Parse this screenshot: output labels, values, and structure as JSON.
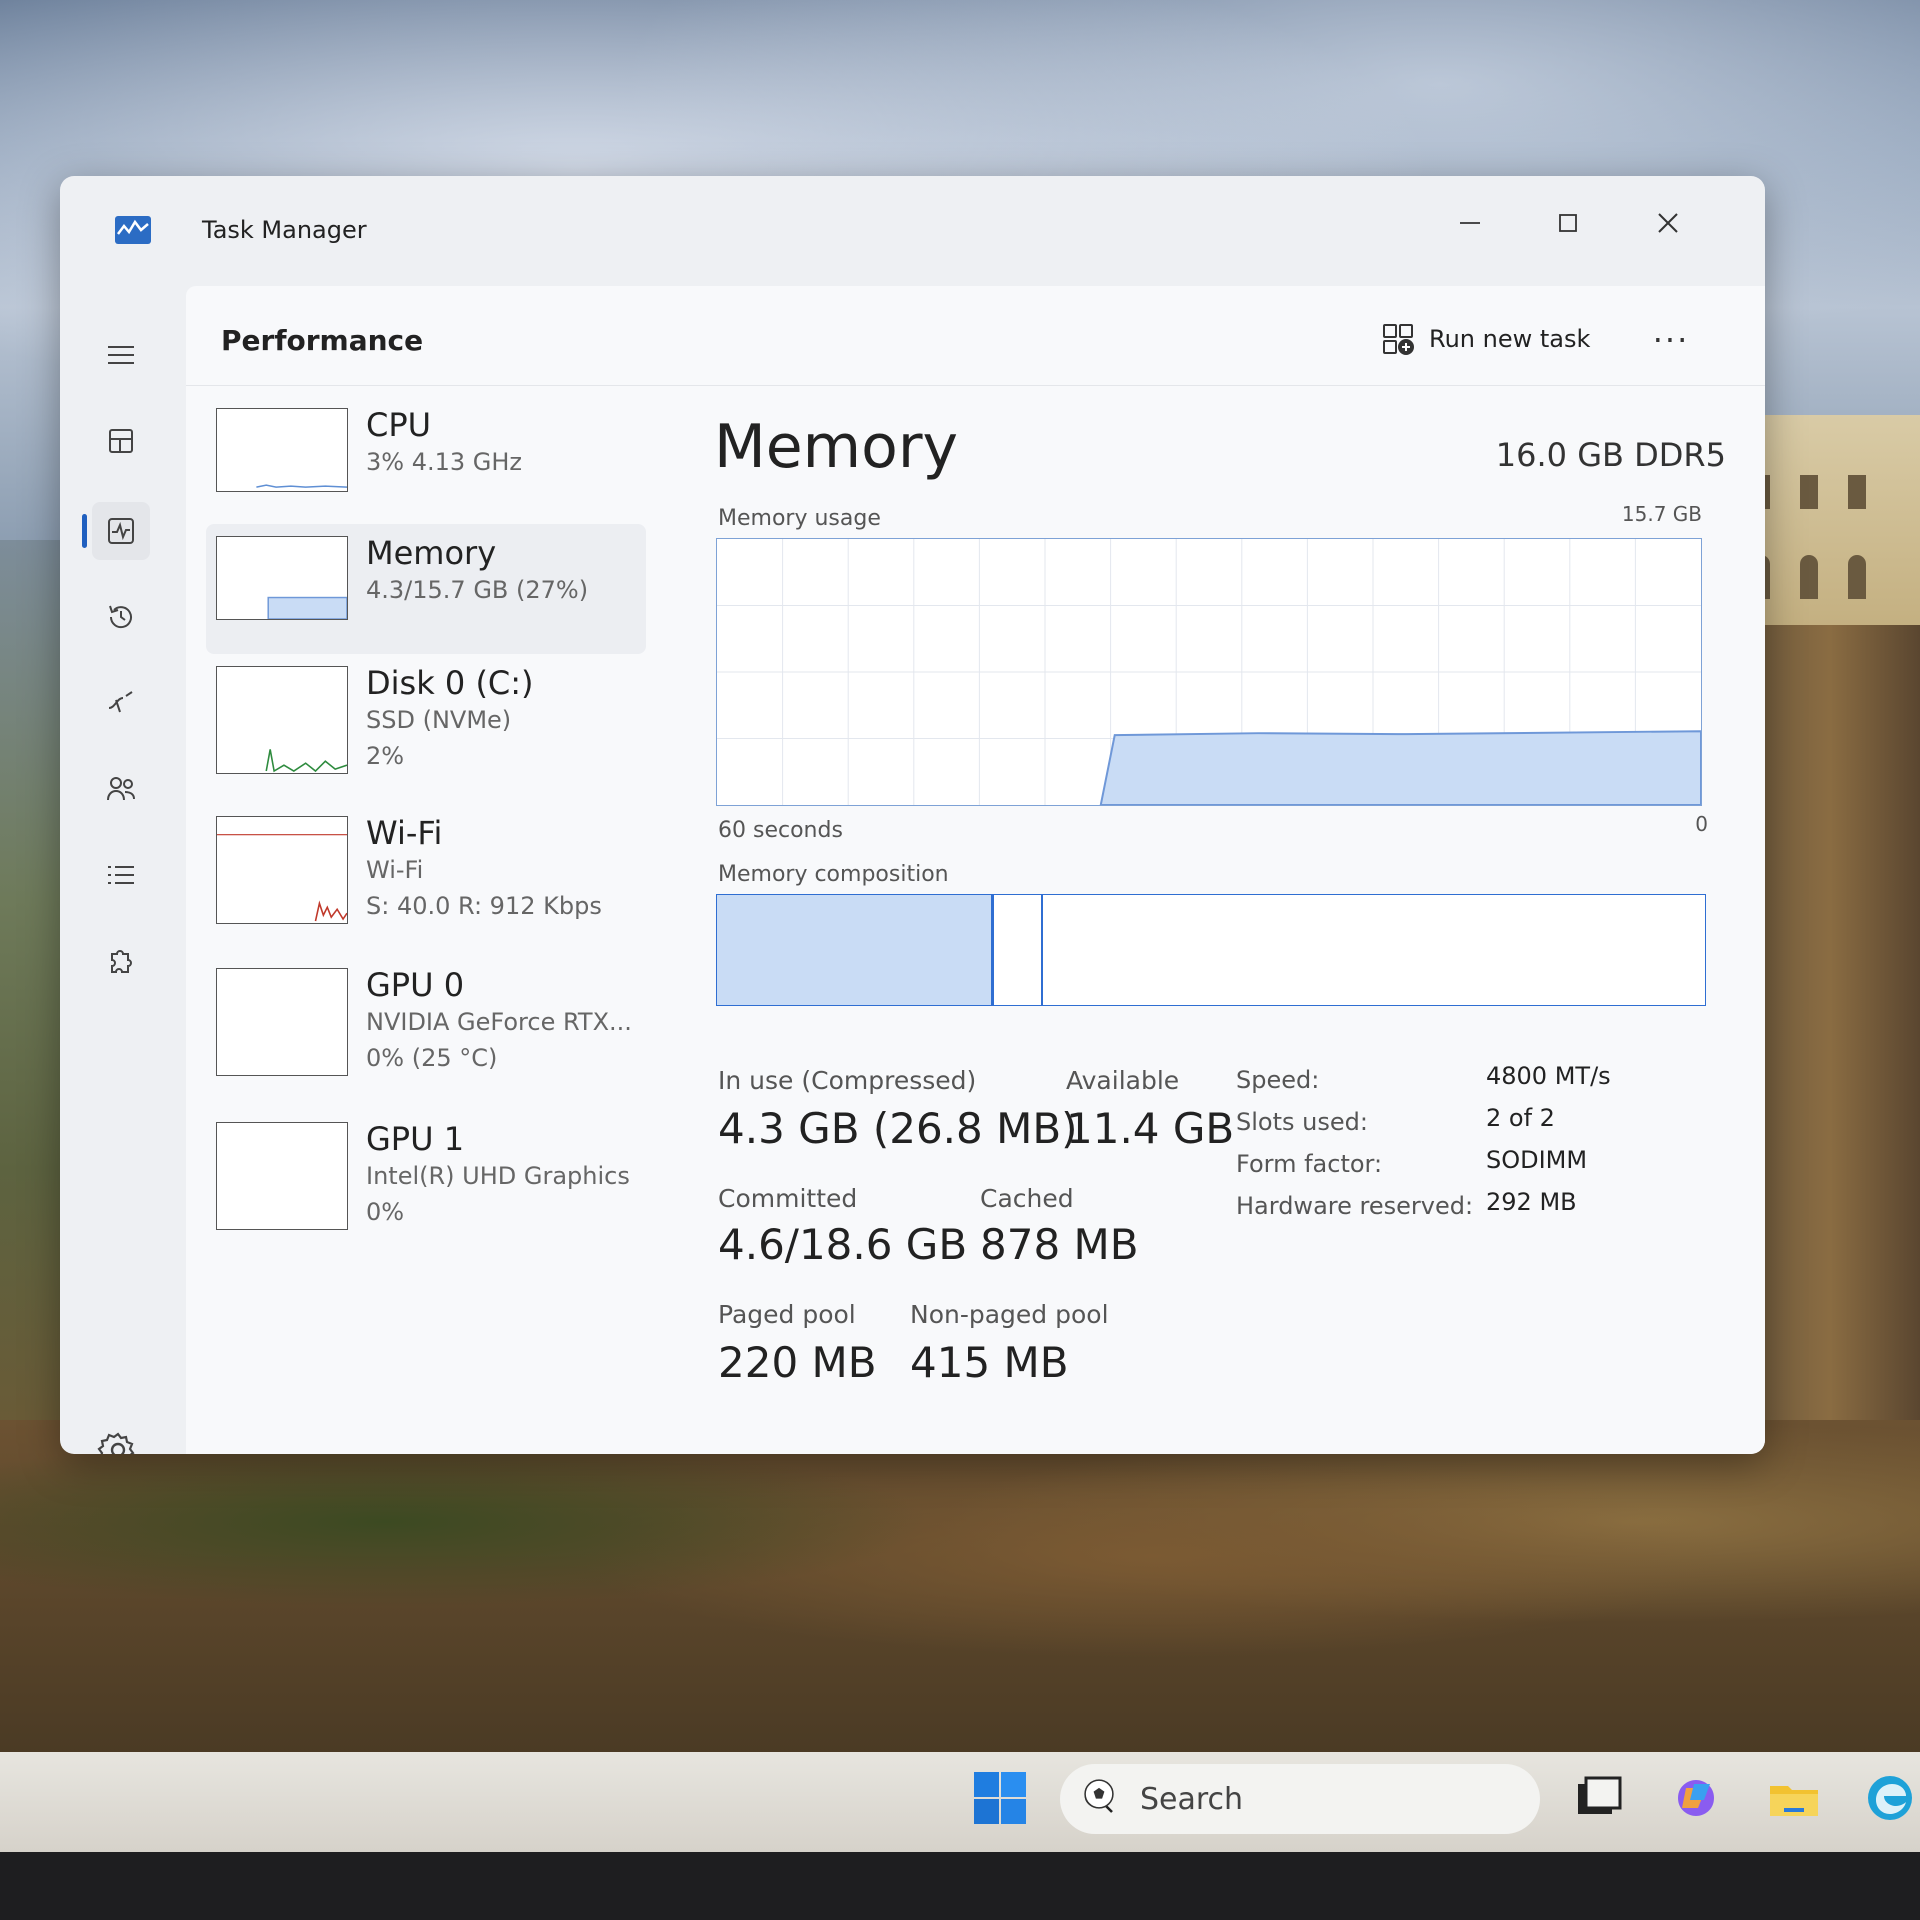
{
  "window": {
    "title": "Task Manager"
  },
  "header": {
    "page_title": "Performance",
    "run_new_task": "Run new task",
    "more": "..."
  },
  "sidebar_items": [
    {
      "name": "CPU",
      "line1": "3%  4.13 GHz",
      "line2": ""
    },
    {
      "name": "Memory",
      "line1": "4.3/15.7 GB (27%)",
      "line2": ""
    },
    {
      "name": "Disk 0 (C:)",
      "line1": "SSD (NVMe)",
      "line2": "2%"
    },
    {
      "name": "Wi-Fi",
      "line1": "Wi-Fi",
      "line2": "S: 40.0  R: 912 Kbps"
    },
    {
      "name": "GPU 0",
      "line1": "NVIDIA GeForce RTX...",
      "line2": "0%  (25 °C)"
    },
    {
      "name": "GPU 1",
      "line1": "Intel(R) UHD Graphics",
      "line2": "0%"
    }
  ],
  "memory": {
    "title": "Memory",
    "spec": "16.0 GB DDR5",
    "usage_label": "Memory usage",
    "usage_max": "15.7 GB",
    "time_label": "60 seconds",
    "zero_label": "0",
    "composition_label": "Memory composition",
    "composition": {
      "in_use_fraction": 0.28,
      "modified_fraction": 0.05
    },
    "usage_level_fraction": 0.27,
    "stats": {
      "in_use_label": "In use (Compressed)",
      "in_use_value": "4.3 GB (26.8 MB)",
      "available_label": "Available",
      "available_value": "11.4 GB",
      "committed_label": "Committed",
      "committed_value": "4.6/18.6 GB",
      "cached_label": "Cached",
      "cached_value": "878 MB",
      "paged_label": "Paged pool",
      "paged_value": "220 MB",
      "nonpaged_label": "Non-paged pool",
      "nonpaged_value": "415 MB"
    },
    "props": {
      "speed_label": "Speed:",
      "speed_value": "4800 MT/s",
      "slots_label": "Slots used:",
      "slots_value": "2 of 2",
      "form_label": "Form factor:",
      "form_value": "SODIMM",
      "reserved_label": "Hardware reserved:",
      "reserved_value": "292 MB"
    }
  },
  "taskbar": {
    "search_placeholder": "Search"
  },
  "colors": {
    "accent": "#1f5fbf",
    "graph_fill": "#c9dcf5",
    "graph_line": "#6f98d8",
    "wifi_line": "#c0392b",
    "disk_line": "#2e8b3e"
  }
}
